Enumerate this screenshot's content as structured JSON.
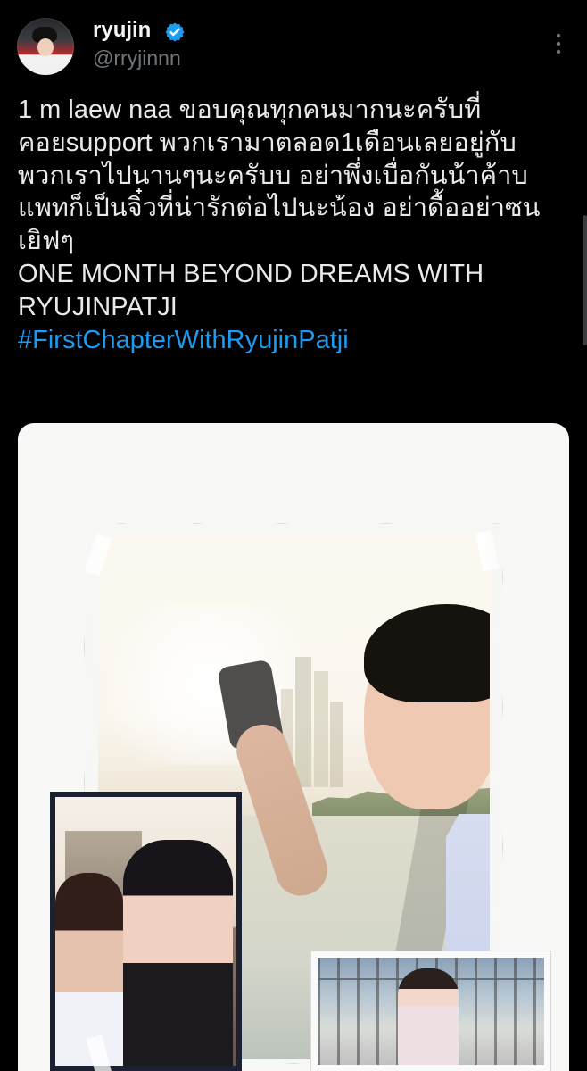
{
  "user": {
    "display_name": "ryujin",
    "handle": "@rryjinnn"
  },
  "tweet": {
    "lines": [
      "1 m laew naa ขอบคุณทุกคนมากนะครับที่",
      "คอยsupport พวกเรามาตลอด1เดือนเลยอยู่กับ",
      "พวกเราไปนานๆนะครับบ อย่าพึ่งเบื่อกันน้าค้าบ",
      "แพทก็เป็นจิ๋วที่น่ารักต่อไปนะน้อง อย่าดื้ออย่าซน",
      "เยิฟๆ",
      "ONE MONTH BEYOND DREAMS WITH",
      "RYUJINPATJI"
    ],
    "hashtag": "#FirstChapterWithRyujinPatji"
  },
  "icons": {
    "verified": "verified-badge-icon",
    "more": "more-options-icon"
  },
  "colors": {
    "background": "#000000",
    "text_primary": "#e7e9ea",
    "text_secondary": "#71767b",
    "accent": "#1d9bf0"
  }
}
